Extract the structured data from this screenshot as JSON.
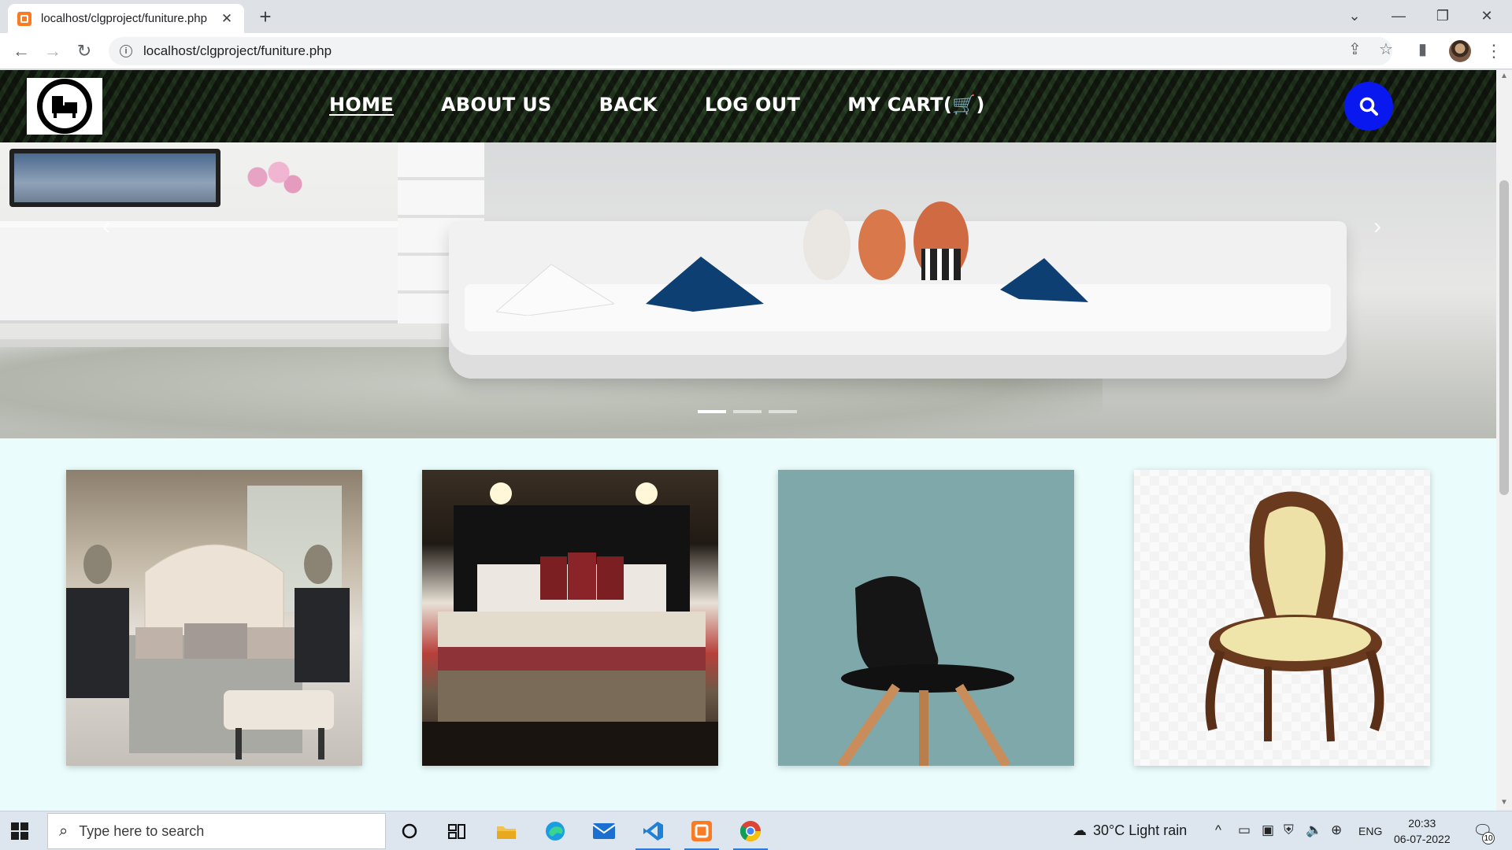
{
  "browser": {
    "tab_title": "localhost/clgproject/funiture.php",
    "tab_close": "✕",
    "new_tab": "+",
    "url": "localhost/clgproject/funiture.php",
    "window_controls": [
      "⌄",
      "—",
      "❐",
      "✕"
    ]
  },
  "site": {
    "nav": [
      {
        "label": "HOME",
        "active": true
      },
      {
        "label": "ABOUT US"
      },
      {
        "label": "BACK"
      },
      {
        "label": "LOG OUT"
      },
      {
        "label": "MY CART(🛒)"
      }
    ],
    "search_icon": "search-icon",
    "carousel": {
      "slides": 3,
      "active_slide": 0
    },
    "products": [
      {
        "image": "bedroom-tufted-bed"
      },
      {
        "image": "hotel-bed-red-pillows"
      },
      {
        "image": "black-scandinavian-chair"
      },
      {
        "image": "carved-wooden-chair"
      }
    ]
  },
  "taskbar": {
    "search_placeholder": "Type here to search",
    "weather": "30°C  Light rain",
    "language": "ENG",
    "time": "20:33",
    "date": "06-07-2022",
    "notification_count": "10"
  },
  "colors": {
    "page_bg": "#eafcfb",
    "search_button": "#0a18f0"
  }
}
